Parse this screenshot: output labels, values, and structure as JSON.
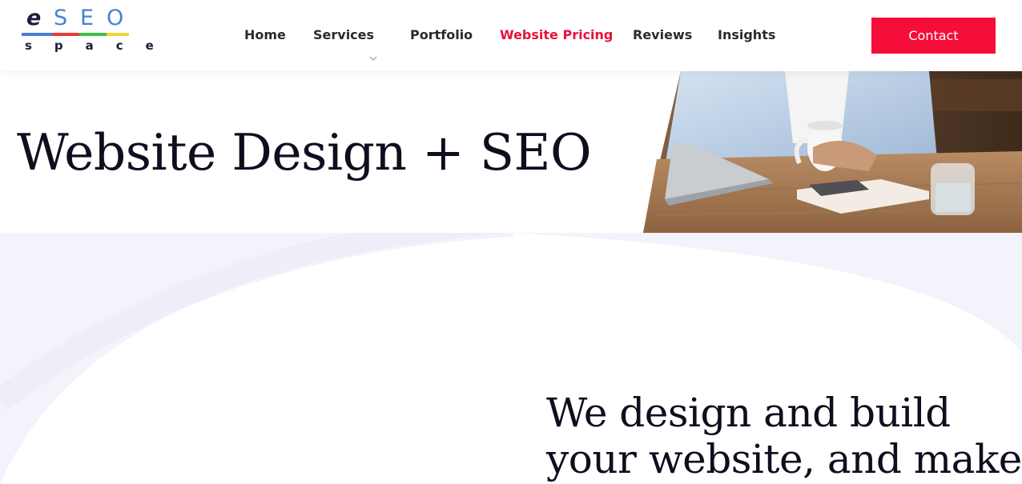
{
  "brand": {
    "logo_letters": [
      "e",
      "S",
      "E",
      "O"
    ],
    "logo_subtext": "space",
    "colors": {
      "dark": "#1b1f3a",
      "blue": "#4a7fd8",
      "red": "#e53b3b",
      "green": "#3cbf4a",
      "yellow": "#f1d33a"
    }
  },
  "nav": {
    "items": [
      {
        "label": "Home",
        "active": false
      },
      {
        "label": "Services",
        "active": false,
        "has_dropdown": true,
        "icon": "chevron-down-icon"
      },
      {
        "label": "Portfolio",
        "active": false
      },
      {
        "label": "Website Pricing",
        "active": true
      },
      {
        "label": "Reviews",
        "active": false
      },
      {
        "label": "Insights",
        "active": false
      }
    ],
    "active_color": "#e8133b",
    "contact_label": "Contact",
    "contact_color": "#f70d3a"
  },
  "hero": {
    "title": "Website Design + SEO",
    "image": "person-with-laptop-and-coffee-photo"
  },
  "intro": {
    "lines": [
      "We design and build",
      "your website, and make"
    ]
  }
}
